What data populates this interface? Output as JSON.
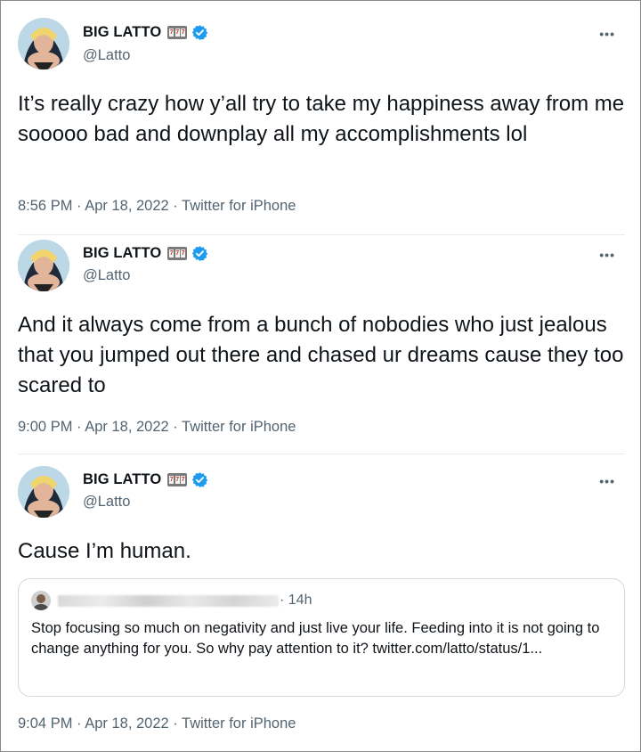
{
  "tweets": [
    {
      "display_name": "BIG LATTO",
      "handle": "@Latto",
      "more": "•••",
      "text": "It’s really crazy how y’all try to take my happiness away from me sooooo bad and downplay all my accomplishments lol",
      "meta": "8:56 PM · Apr 18, 2022 · Twitter for iPhone"
    },
    {
      "display_name": "BIG LATTO",
      "handle": "@Latto",
      "more": "•••",
      "text": "And it always come from a bunch of nobodies who just jealous that you jumped out there and chased ur dreams cause they too scared to",
      "meta": "9:00 PM · Apr 18, 2022 · Twitter for iPhone"
    },
    {
      "display_name": "BIG LATTO",
      "handle": "@Latto",
      "more": "•••",
      "text": "Cause I’m human.",
      "meta": "9:04 PM · Apr 18, 2022 · Twitter for iPhone",
      "quote": {
        "time": "· 14h",
        "text": "Stop focusing so much on  negativity and just live your life. Feeding into it is not going to change anything for you. So why pay attention to it? twitter.com/latto/status/1..."
      }
    }
  ],
  "emoji": {
    "slot_symbols": [
      "7",
      "7",
      "7"
    ]
  },
  "colors": {
    "verified": "#1d9bf0",
    "secondary_text": "#536471",
    "primary_text": "#0f1419"
  },
  "icons": {
    "verified": "verified-badge-icon",
    "more": "more-options-icon"
  }
}
